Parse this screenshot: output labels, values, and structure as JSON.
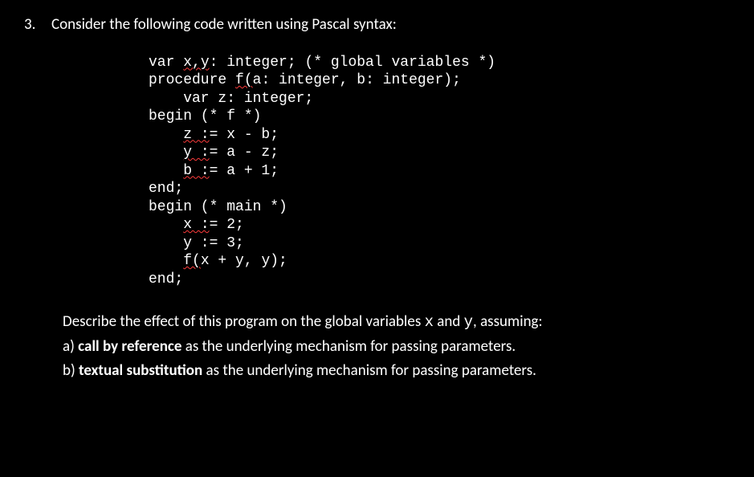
{
  "question": {
    "number": "3.",
    "prompt": "Consider the following code written using Pascal syntax:"
  },
  "code": {
    "l01a": "var ",
    "l01b": "x,y",
    "l01c": ": integer; (* global variables *)",
    "l02": "",
    "l03a": "procedure ",
    "l03b": "f(",
    "l03c": "a: integer, b: integer);",
    "l04": "    var z: integer;",
    "l05": "begin (* f *)",
    "l06a": "    ",
    "l06b": "z :",
    "l06c": "= x - b;",
    "l07a": "    ",
    "l07b": "y :",
    "l07c": "= a - z;",
    "l08a": "    ",
    "l08b": "b :",
    "l08c": "= a + 1;",
    "l09": "end;",
    "l10": "",
    "l11": "begin (* main *)",
    "l12a": "    ",
    "l12b": "x :",
    "l12c": "= 2;",
    "l13": "    y := 3;",
    "l14a": "    ",
    "l14b": "f(",
    "l14c": "x + y, y);",
    "l15": "end;"
  },
  "bottom": {
    "describe_a": "Describe the effect of this program on the global variables ",
    "var_x": "x",
    "and_word": " and ",
    "var_y": "y",
    "describe_b": ", assuming:",
    "part_a_prefix": "a) ",
    "part_a_bold": "call by reference",
    "part_a_suffix": " as the underlying mechanism for passing parameters.",
    "part_b_prefix": "b) ",
    "part_b_bold": "textual substitution",
    "part_b_suffix": " as the underlying mechanism for passing parameters."
  }
}
